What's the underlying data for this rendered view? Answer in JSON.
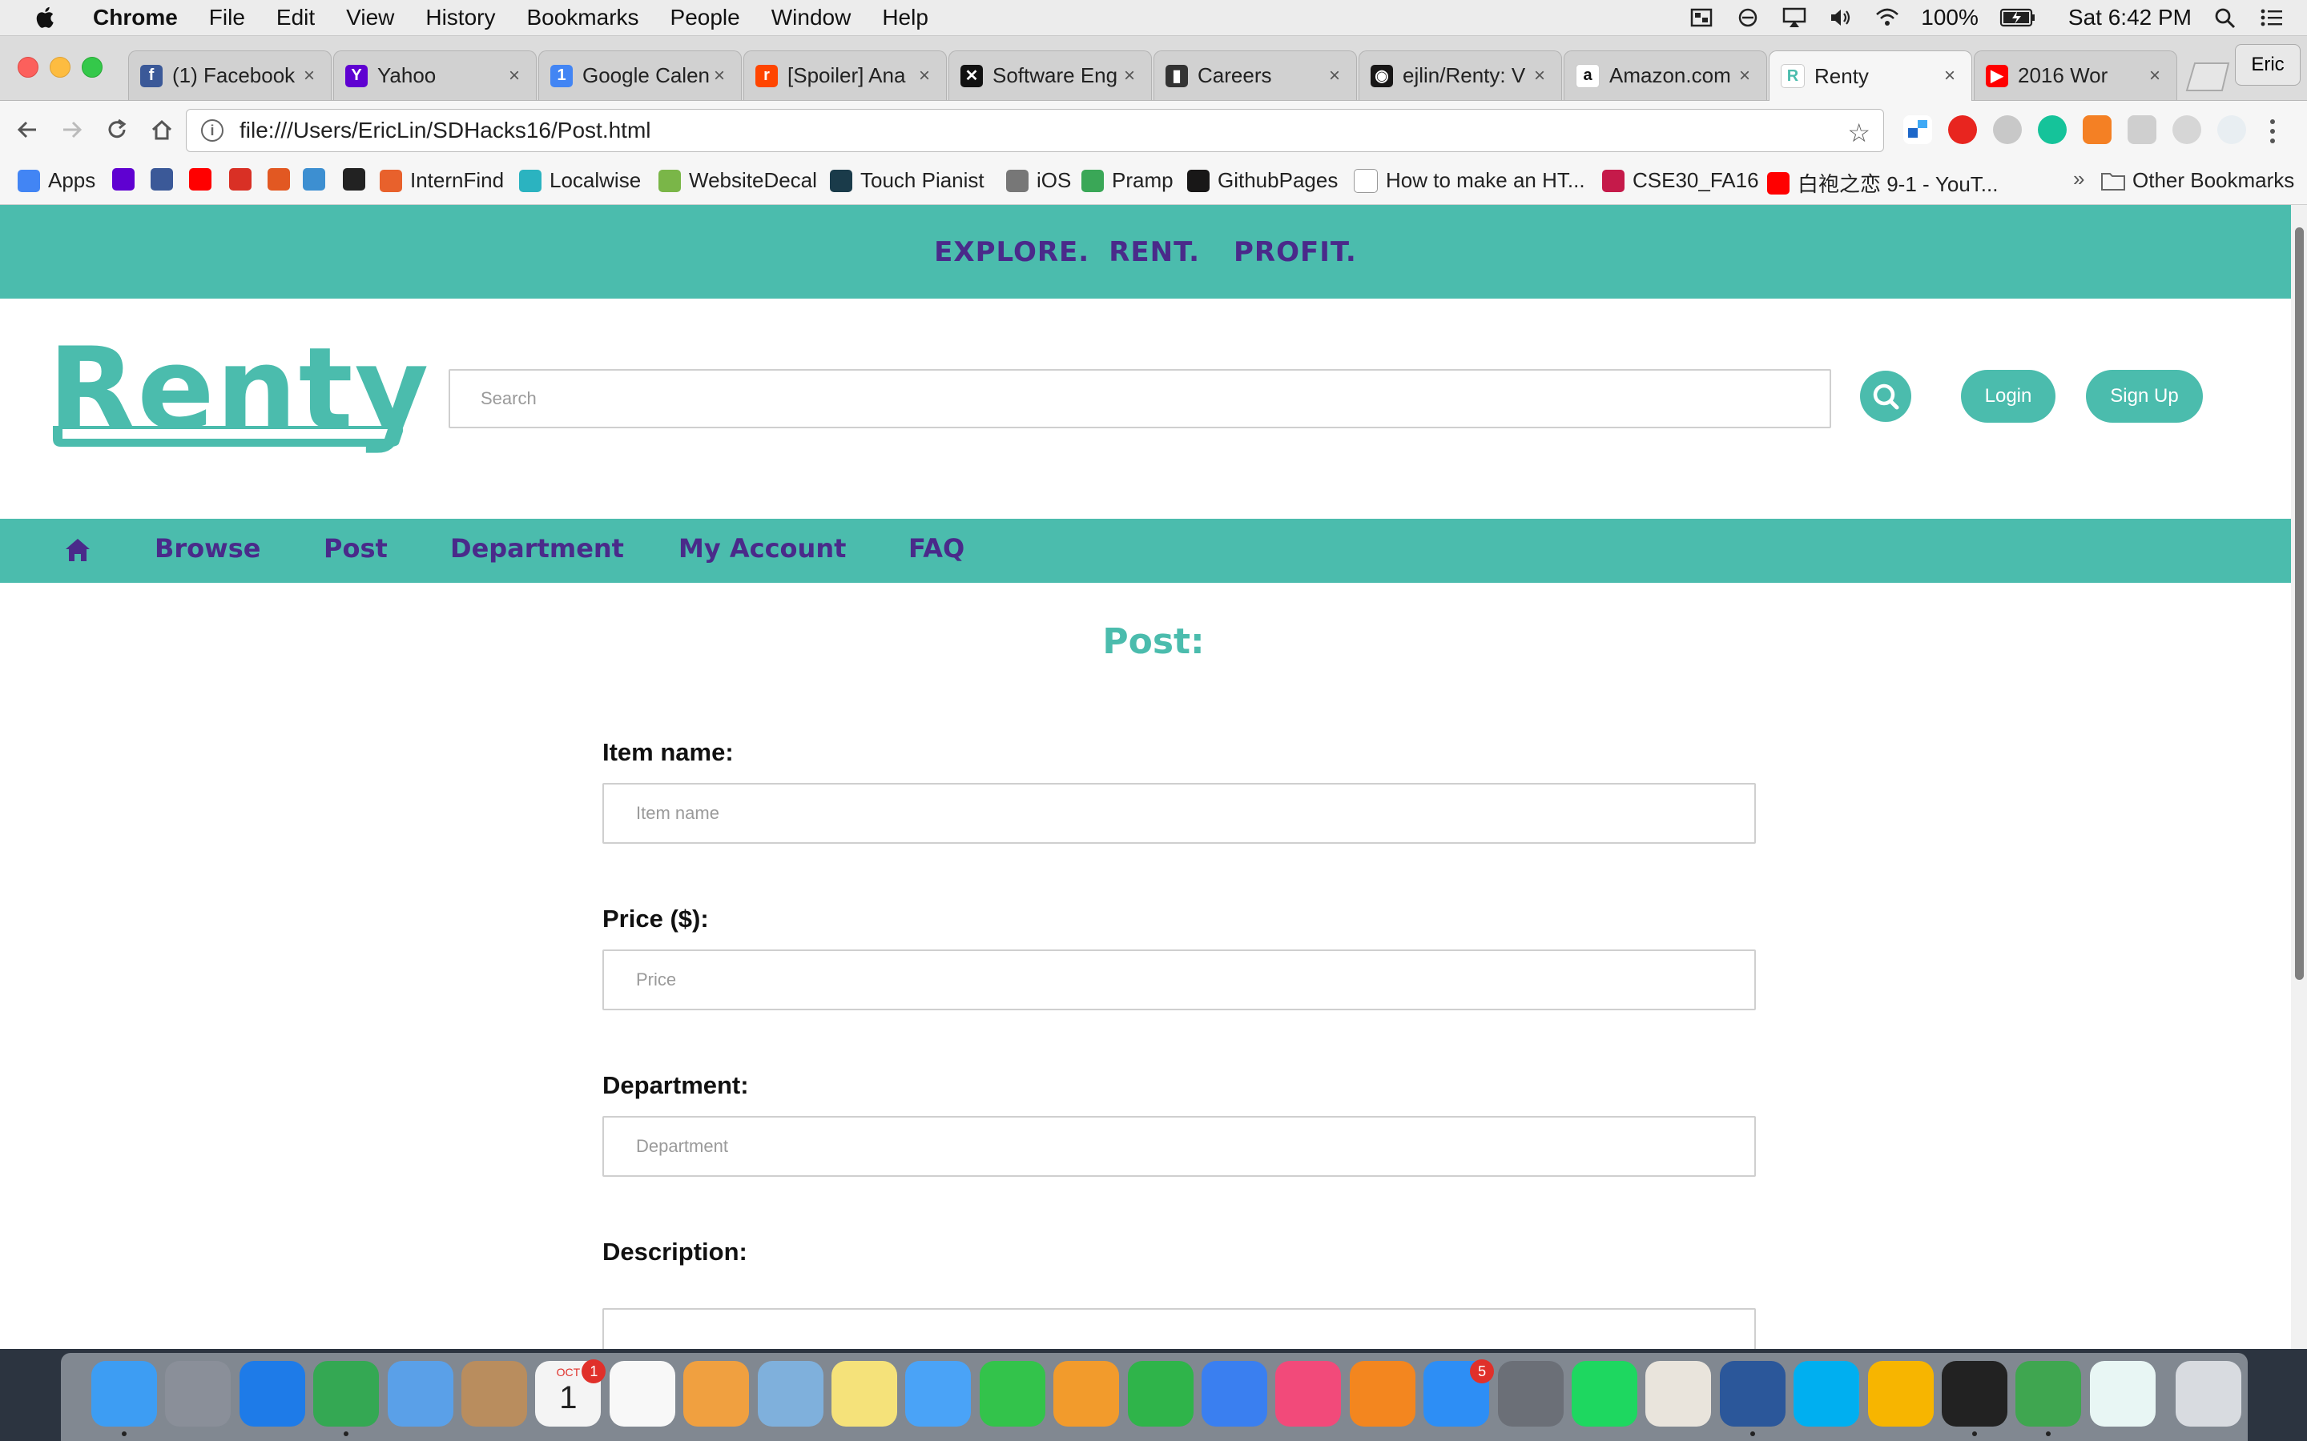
{
  "menubar": {
    "app_name": "Chrome",
    "menus": [
      "File",
      "Edit",
      "View",
      "History",
      "Bookmarks",
      "People",
      "Window",
      "Help"
    ],
    "battery": "100%",
    "clock": "Sat 6:42 PM"
  },
  "browser": {
    "tabs": [
      {
        "title": "(1) Facebook",
        "favicon_color": "#3b5998",
        "favicon": "f"
      },
      {
        "title": "Yahoo",
        "favicon_color": "#5f01d1",
        "favicon": "Y"
      },
      {
        "title": "Google Calen",
        "favicon_color": "#4285f4",
        "favicon": "1"
      },
      {
        "title": "[Spoiler] Ana",
        "favicon_color": "#ff4500",
        "favicon": "r"
      },
      {
        "title": "Software Eng",
        "favicon_color": "#111111",
        "favicon": "✕"
      },
      {
        "title": "Careers",
        "favicon_color": "#333333",
        "favicon": "▮"
      },
      {
        "title": "ejlin/Renty: V",
        "favicon_color": "#181717",
        "favicon": "◉"
      },
      {
        "title": "Amazon.com",
        "favicon_color": "#ffffff",
        "favicon": "a"
      },
      {
        "title": "Renty",
        "favicon_color": "#ffffff",
        "favicon": "R",
        "active": true
      },
      {
        "title": "2016 Wor",
        "favicon_color": "#ff0000",
        "favicon": "▶"
      }
    ],
    "profile_name": "Eric",
    "url": "file:///Users/EricLin/SDHacks16/Post.html",
    "bookmarks": [
      {
        "label": "Apps",
        "color": "#4285f4"
      },
      {
        "label": "",
        "color": "#5f01d1"
      },
      {
        "label": "",
        "color": "#3b5998"
      },
      {
        "label": "",
        "color": "#ff0000"
      },
      {
        "label": "",
        "color": "#d93025"
      },
      {
        "label": "",
        "color": "#e25822"
      },
      {
        "label": "",
        "color": "#3d8fd1"
      },
      {
        "label": "",
        "color": "#222222"
      },
      {
        "label": "InternFind",
        "color": "#e8612c"
      },
      {
        "label": "Localwise",
        "color": "#2bb3c0"
      },
      {
        "label": "WebsiteDecal",
        "color": "#7ab648"
      },
      {
        "label": "Touch Pianist",
        "color": "#1a3b4a"
      },
      {
        "label": "iOS",
        "color": "#777777"
      },
      {
        "label": "Pramp",
        "color": "#3aa757"
      },
      {
        "label": "GithubPages",
        "color": "#181717"
      },
      {
        "label": "How to make an HT...",
        "color": "#ffffff"
      },
      {
        "label": "CSE30_FA16",
        "color": "#c51a4a"
      },
      {
        "label": "白袍之恋 9-1 - YouT...",
        "color": "#ff0000"
      }
    ],
    "other_bookmarks": "Other Bookmarks",
    "overflow_chevron": "»"
  },
  "site": {
    "banner": [
      "EXPLORE.",
      "RENT.",
      "PROFIT."
    ],
    "logo": "Renty",
    "search_placeholder": "Search",
    "login_label": "Login",
    "signup_label": "Sign Up",
    "nav": [
      "Browse",
      "Post",
      "Department",
      "My Account",
      "FAQ"
    ],
    "colors": {
      "teal": "#4bbcad",
      "purple": "#4a2a8a"
    }
  },
  "form": {
    "title": "Post:",
    "fields": [
      {
        "label": "Item name:",
        "placeholder": "Item name"
      },
      {
        "label": "Price ($):",
        "placeholder": "Price"
      },
      {
        "label": "Department:",
        "placeholder": "Department"
      },
      {
        "label": "Description:",
        "placeholder": ""
      }
    ]
  },
  "dock": {
    "apps": [
      {
        "name": "Finder",
        "color": "#3d9df3",
        "running": true
      },
      {
        "name": "Launchpad",
        "color": "#8a8f99"
      },
      {
        "name": "Safari",
        "color": "#1e7be8"
      },
      {
        "name": "Chrome",
        "color": "#34a853",
        "running": true
      },
      {
        "name": "Mail",
        "color": "#5aa0e8"
      },
      {
        "name": "Contacts",
        "color": "#b98d5e"
      },
      {
        "name": "Calendar",
        "color": "#f4f4f4",
        "badge": "1",
        "date_month": "OCT",
        "date_day": "1"
      },
      {
        "name": "Reminders",
        "color": "#f8f8f8"
      },
      {
        "name": "Photos",
        "color": "#f0a040"
      },
      {
        "name": "Preview",
        "color": "#7fb0dc"
      },
      {
        "name": "Notes",
        "color": "#f5e27a"
      },
      {
        "name": "Messages",
        "color": "#4aa3f7"
      },
      {
        "name": "FaceTime",
        "color": "#33c34b"
      },
      {
        "name": "Pages",
        "color": "#f29b2c"
      },
      {
        "name": "Numbers",
        "color": "#2fb44a"
      },
      {
        "name": "Keynote",
        "color": "#3a7ff0"
      },
      {
        "name": "iTunes",
        "color": "#f24a7a"
      },
      {
        "name": "iBooks",
        "color": "#f3861f"
      },
      {
        "name": "App Store",
        "color": "#2d8ef5",
        "badge": "5"
      },
      {
        "name": "System Preferences",
        "color": "#6b6f77"
      },
      {
        "name": "Spotify",
        "color": "#1ed760"
      },
      {
        "name": "Slack",
        "color": "#e9e4dc"
      },
      {
        "name": "Word",
        "color": "#2b579a",
        "running": true
      },
      {
        "name": "Skype",
        "color": "#00aff0"
      },
      {
        "name": "Sketch",
        "color": "#f7b500"
      },
      {
        "name": "Terminal",
        "color": "#222222",
        "running": true
      },
      {
        "name": "Vim",
        "color": "#3fa650",
        "running": true
      },
      {
        "name": "Renty",
        "color": "#e8f6f4"
      },
      {
        "name": "Trash",
        "color": "#d8dbe0"
      }
    ]
  }
}
